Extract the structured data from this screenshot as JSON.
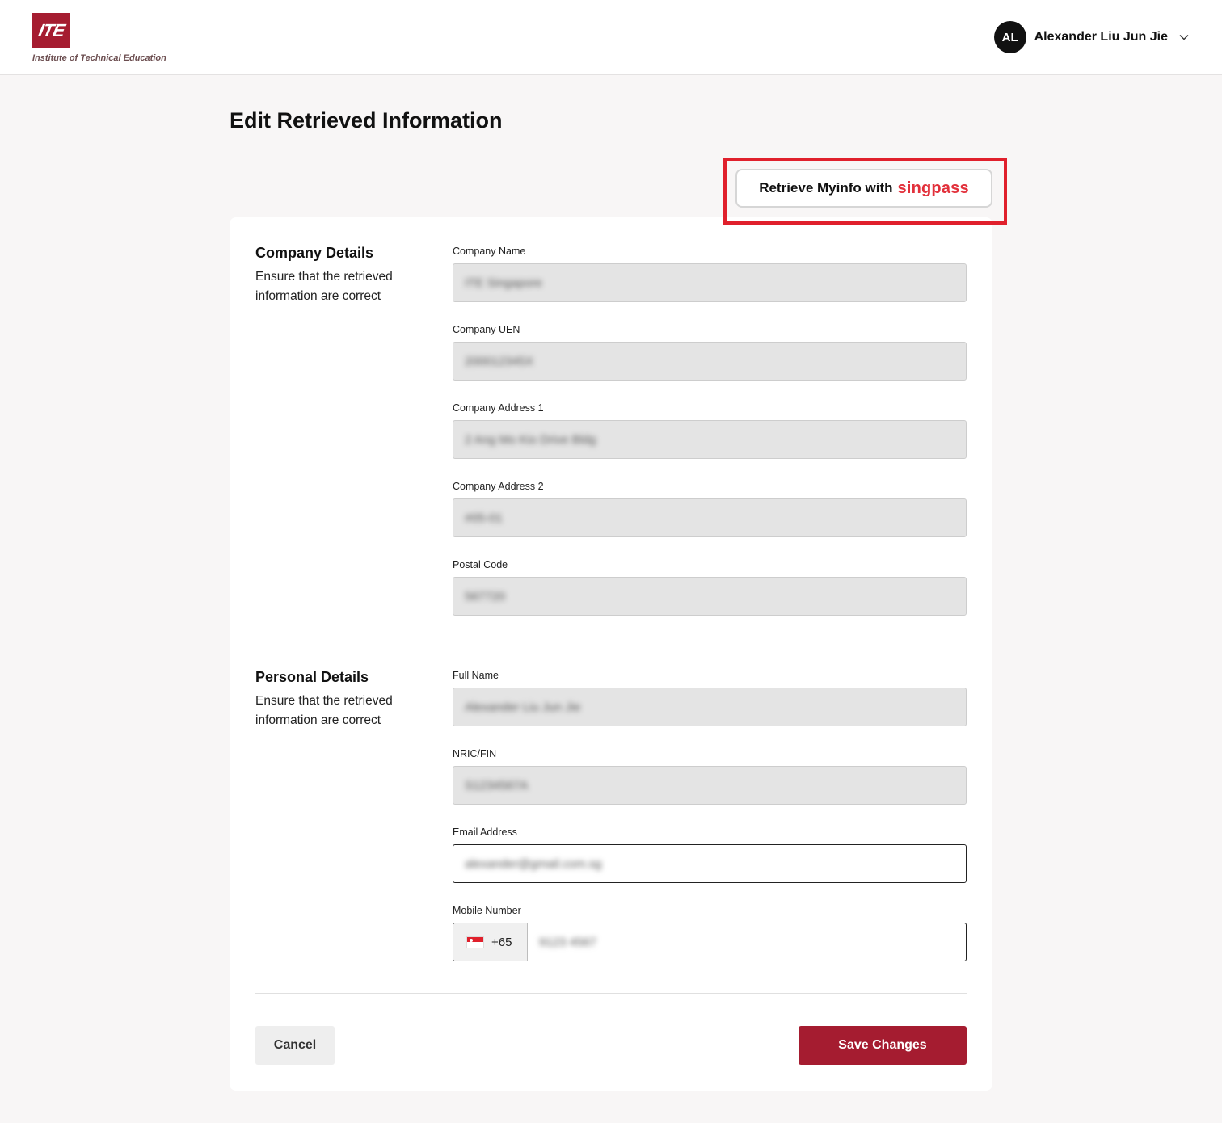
{
  "header": {
    "logo_mark": "ITE",
    "logo_text": "Institute of Technical Education",
    "user_initials": "AL",
    "user_name": "Alexander Liu Jun Jie"
  },
  "page": {
    "title": "Edit Retrieved Information"
  },
  "singpass_button": {
    "label": "Retrieve Myinfo with",
    "brand": "singpass"
  },
  "company_section": {
    "title": "Company Details",
    "description": "Ensure that the retrieved information are correct",
    "fields": [
      {
        "label": "Company Name",
        "value": "ITE Singapore"
      },
      {
        "label": "Company UEN",
        "value": "200012345X"
      },
      {
        "label": "Company Address 1",
        "value": "2 Ang Mo Kio Drive Bldg"
      },
      {
        "label": "Company Address 2",
        "value": "#05-01"
      },
      {
        "label": "Postal Code",
        "value": "567720"
      }
    ]
  },
  "personal_section": {
    "title": "Personal Details",
    "description": "Ensure that the retrieved information are correct",
    "fields": [
      {
        "label": "Full Name",
        "value": "Alexander Liu Jun Jie"
      },
      {
        "label": "NRIC/FIN",
        "value": "S1234567A"
      },
      {
        "label": "Email Address",
        "value": "alexander@gmail.com.sg"
      },
      {
        "label": "Mobile Number",
        "value": "9123 4567",
        "country_code": "+65"
      }
    ]
  },
  "actions": {
    "cancel": "Cancel",
    "save": "Save Changes"
  },
  "colors": {
    "brand": "#a51c30",
    "singpass_red": "#e2303b",
    "highlight": "#e0202c"
  }
}
